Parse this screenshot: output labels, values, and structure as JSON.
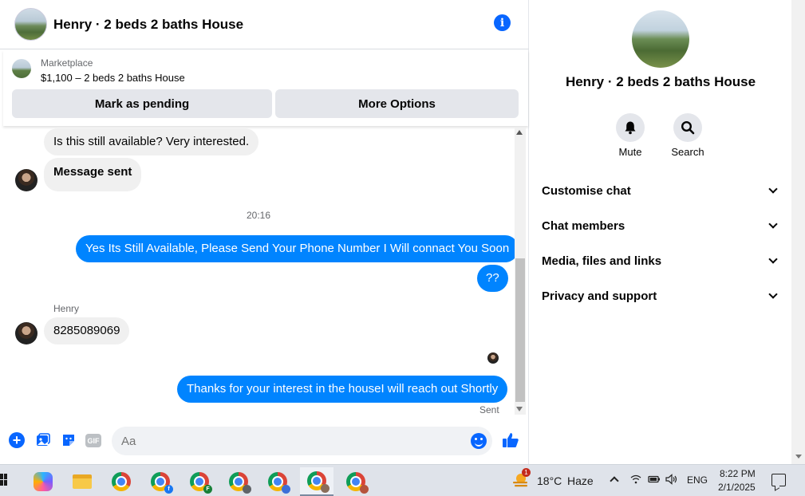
{
  "chat": {
    "header_title": "Henry · 2 beds 2 baths House",
    "marketplace": {
      "label": "Marketplace",
      "listing": "$1,100 – 2 beds 2 baths House",
      "mark_pending": "Mark as pending",
      "more_options": "More Options"
    },
    "messages": {
      "m1": "Is this still available? Very interested.",
      "m2": "Message sent",
      "timestamp": "20:16",
      "m3": "Yes Its Still Available, Please Send Your Phone Number I Will connact You Soon",
      "m4": "??",
      "sender": "Henry",
      "m5": "8285089069",
      "m6": "Thanks for your interest in the houseI will reach out Shortly",
      "status": "Sent"
    },
    "composer": {
      "placeholder": "Aa",
      "gif_label": "GIF"
    }
  },
  "info_panel": {
    "name": "Henry · 2 beds 2 baths House",
    "mute_label": "Mute",
    "search_label": "Search",
    "sections": [
      "Customise chat",
      "Chat members",
      "Media, files and links",
      "Privacy and support"
    ]
  },
  "taskbar": {
    "weather_temp": "18°C",
    "weather_desc": "Haze",
    "weather_badge": "1",
    "language": "ENG",
    "time": "8:22 PM",
    "date": "2/1/2025",
    "profile_badges": [
      "f",
      "F"
    ]
  },
  "colors": {
    "accent": "#0866ff",
    "outgoing_bubble": "#0084ff",
    "incoming_bubble": "#f0f0f0"
  }
}
